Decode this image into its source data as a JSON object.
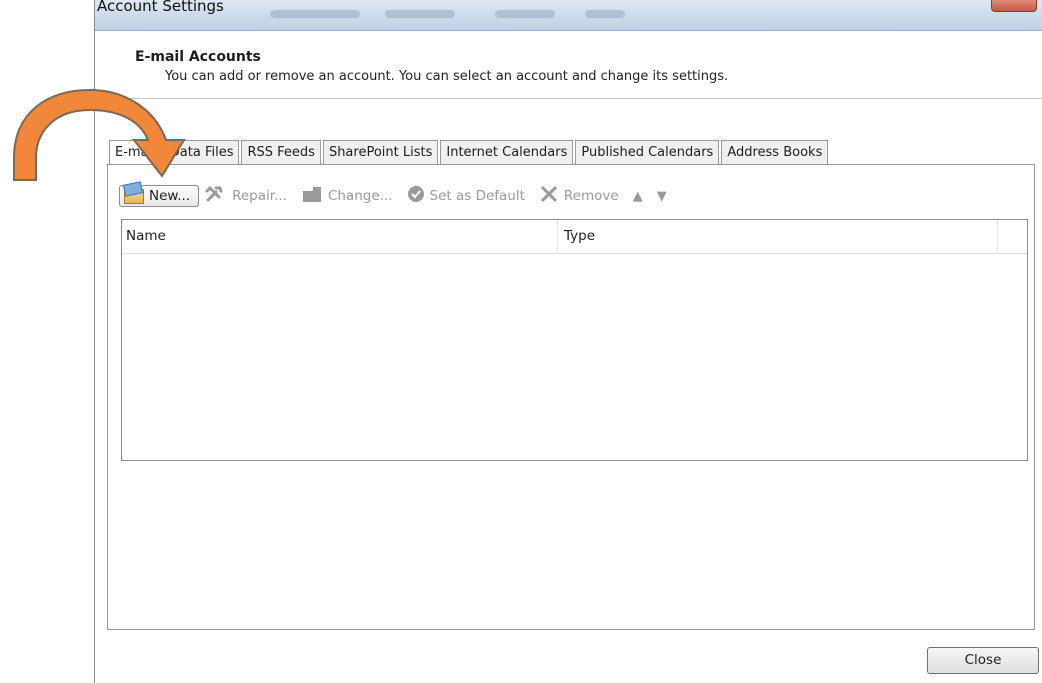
{
  "window": {
    "title": "Account Settings"
  },
  "header": {
    "title": "E-mail Accounts",
    "description": "You can add or remove an account. You can select an account and change its settings."
  },
  "tabs": [
    {
      "label": "E-mail",
      "active": true
    },
    {
      "label": "Data Files"
    },
    {
      "label": "RSS Feeds"
    },
    {
      "label": "SharePoint Lists"
    },
    {
      "label": "Internet Calendars"
    },
    {
      "label": "Published Calendars"
    },
    {
      "label": "Address Books"
    }
  ],
  "toolbar": {
    "new_label": "New...",
    "repair_label": "Repair...",
    "change_label": "Change...",
    "default_label": "Set as Default",
    "remove_label": "Remove"
  },
  "list": {
    "columns": [
      "Name",
      "Type"
    ]
  },
  "footer": {
    "close_label": "Close"
  },
  "colors": {
    "annotation_arrow": "#f0873a",
    "titlebar": "#cbd9ea"
  }
}
